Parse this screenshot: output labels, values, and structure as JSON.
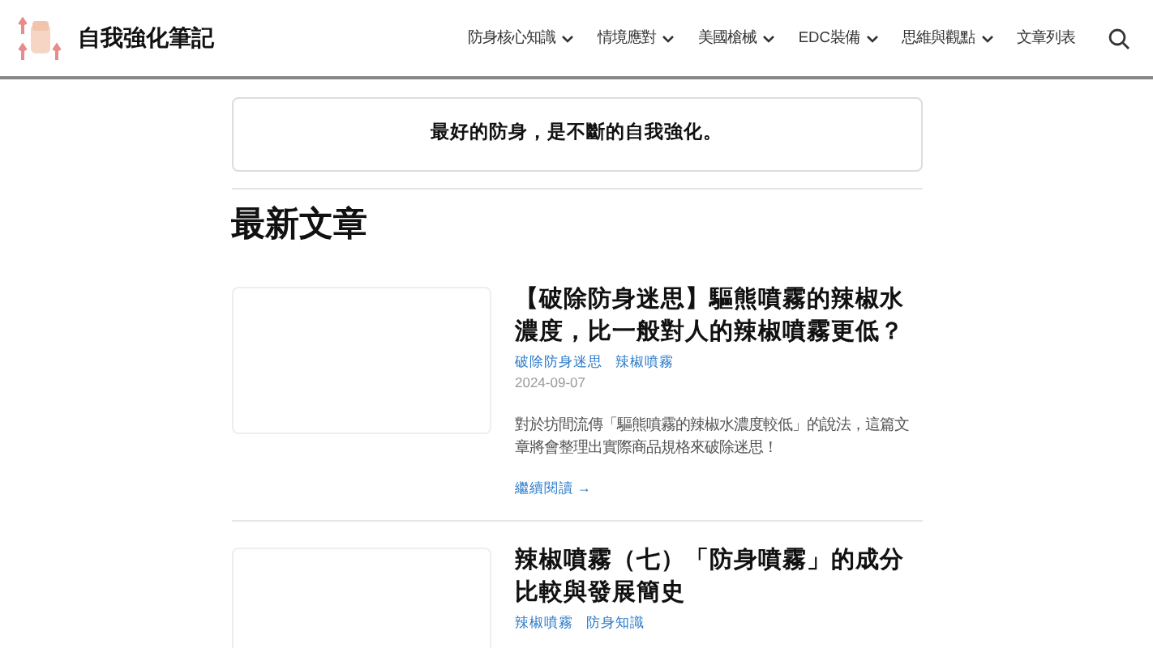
{
  "site": {
    "title": "自我強化筆記"
  },
  "nav": [
    {
      "label": "防身核心知識",
      "dropdown": true
    },
    {
      "label": "情境應對",
      "dropdown": true
    },
    {
      "label": "美國槍械",
      "dropdown": true
    },
    {
      "label": "EDC裝備",
      "dropdown": true
    },
    {
      "label": "思維與觀點",
      "dropdown": true
    },
    {
      "label": "文章列表",
      "dropdown": false
    }
  ],
  "tagline": "最好的防身，是不斷的自我強化。",
  "section_title": "最新文章",
  "posts": [
    {
      "title": "【破除防身迷思】驅熊噴霧的辣椒水濃度，比一般對人的辣椒噴霧更低？",
      "tags": [
        "破除防身迷思",
        "辣椒噴霧"
      ],
      "date": "2024-09-07",
      "excerpt": "對於坊間流傳「驅熊噴霧的辣椒水濃度較低」的說法，這篇文章將會整理出實際商品規格來破除迷思！",
      "read_more": "繼續閱讀 →"
    },
    {
      "title": "辣椒噴霧（七）「防身噴霧」的成分比較與發展簡史",
      "tags": [
        "辣椒噴霧",
        "防身知識"
      ]
    }
  ]
}
